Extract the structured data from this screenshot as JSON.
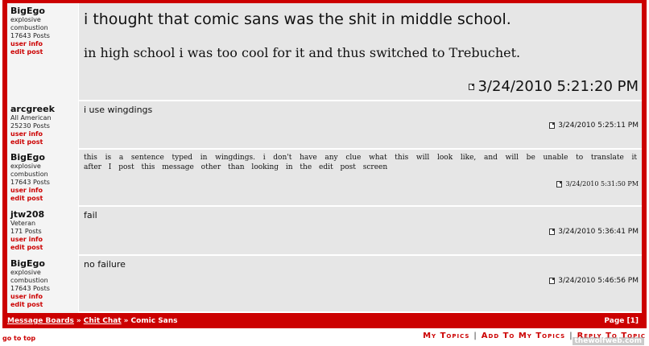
{
  "posts": [
    {
      "username": "BigEgo",
      "title": "explosive combustion",
      "post_count": "17643 Posts",
      "user_info": "user info",
      "edit_post": "edit post",
      "lines": [
        "i thought that comic sans was the shit in middle school.",
        "in high school i was too cool for it and thus switched to Trebuchet."
      ],
      "timestamp": "3/24/2010 5:21:20 PM"
    },
    {
      "username": "arcgreek",
      "title": "All American",
      "post_count": "25230 Posts",
      "user_info": "user info",
      "edit_post": "edit post",
      "lines": [
        "i use wingdings"
      ],
      "timestamp": "3/24/2010 5:25:11 PM"
    },
    {
      "username": "BigEgo",
      "title": "explosive combustion",
      "post_count": "17643 Posts",
      "user_info": "user info",
      "edit_post": "edit post",
      "lines": [
        "this is a sentence typed in wingdings. i don't have any clue what this will look like, and will be unable to translate it after I post this message other than looking in the edit post screen"
      ],
      "timestamp": "3/24/2010 5:31:50 PM"
    },
    {
      "username": "jtw208",
      "title": "Veteran",
      "post_count": "171 Posts",
      "user_info": "user info",
      "edit_post": "edit post",
      "lines": [
        "fail"
      ],
      "timestamp": "3/24/2010 5:36:41 PM"
    },
    {
      "username": "BigEgo",
      "title": "explosive combustion",
      "post_count": "17643 Posts",
      "user_info": "user info",
      "edit_post": "edit post",
      "lines": [
        "no failure"
      ],
      "timestamp": "3/24/2010 5:46:56 PM"
    }
  ],
  "breadcrumb": {
    "boards": "Message Boards",
    "separator": "»",
    "chit_chat": "Chit Chat",
    "topic": "Comic Sans",
    "page": "Page [1]"
  },
  "footer": {
    "go_to_top": "go to top",
    "my_topics": "My Topics",
    "add_to_my_topics": "Add To My Topics",
    "reply_to_topic": "Reply To Topic",
    "divider": "|",
    "watermark": "thewolfweb.com"
  },
  "colors": {
    "accent": "#cc0000",
    "post_bg": "#e6e6e6",
    "author_bg": "#f4f4f4"
  }
}
